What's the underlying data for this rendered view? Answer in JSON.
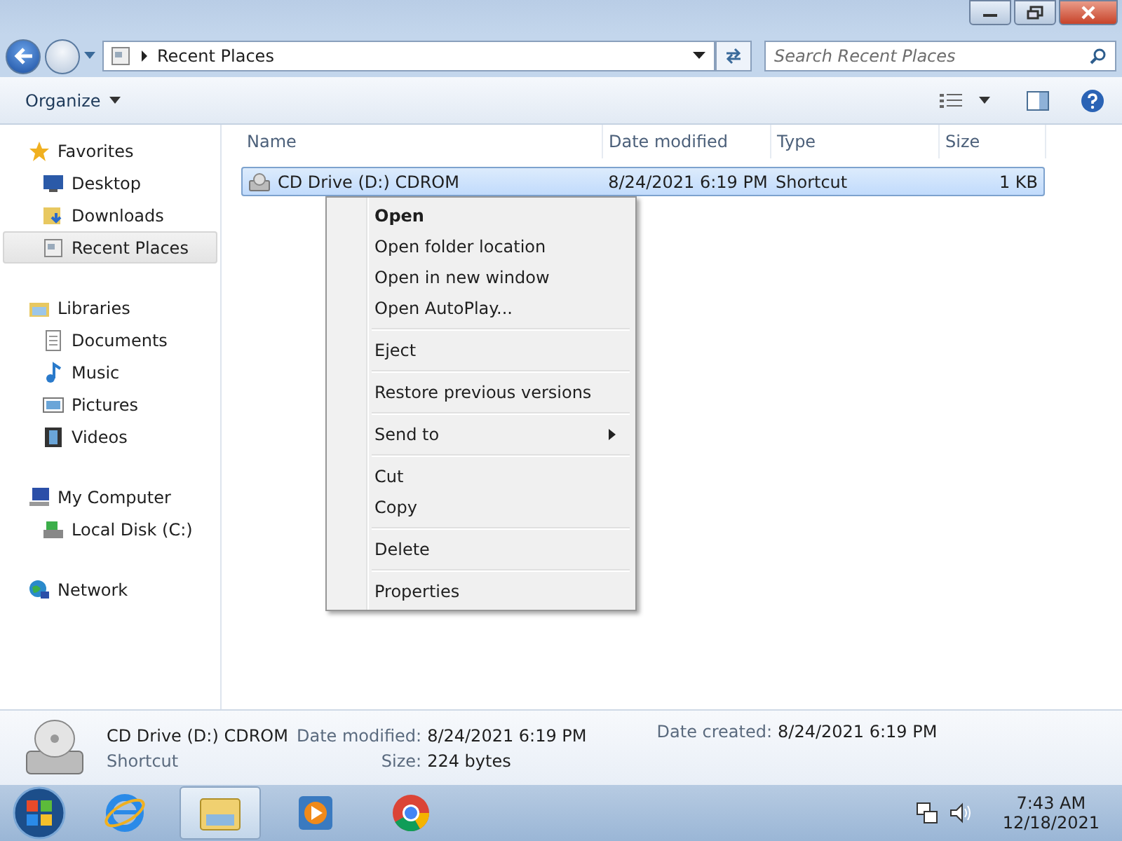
{
  "address_bar": {
    "location": "Recent Places"
  },
  "search": {
    "placeholder": "Search Recent Places"
  },
  "toolbar": {
    "organize": "Organize"
  },
  "sidebar": {
    "groups": [
      {
        "label": "Favorites",
        "selected": false,
        "children": [
          {
            "label": "Desktop",
            "selected": false
          },
          {
            "label": "Downloads",
            "selected": false
          },
          {
            "label": "Recent Places",
            "selected": true
          }
        ]
      },
      {
        "label": "Libraries",
        "selected": false,
        "children": [
          {
            "label": "Documents",
            "selected": false
          },
          {
            "label": "Music",
            "selected": false
          },
          {
            "label": "Pictures",
            "selected": false
          },
          {
            "label": "Videos",
            "selected": false
          }
        ]
      },
      {
        "label": "My Computer",
        "selected": false,
        "children": [
          {
            "label": "Local Disk (C:)",
            "selected": false
          }
        ]
      },
      {
        "label": "Network",
        "selected": false
      }
    ]
  },
  "table": {
    "columns": [
      "Name",
      "Date modified",
      "Type",
      "Size"
    ],
    "rows": [
      {
        "name": "CD Drive (D:) CDROM",
        "date_modified": "8/24/2021 6:19 PM",
        "type": "Shortcut",
        "size": "1 KB",
        "selected": true
      }
    ]
  },
  "context_menu": {
    "groups": [
      [
        {
          "label": "Open",
          "default": true,
          "submenu": false
        },
        {
          "label": "Open folder location",
          "default": false,
          "submenu": false
        },
        {
          "label": "Open in new window",
          "default": false,
          "submenu": false
        },
        {
          "label": "Open AutoPlay...",
          "default": false,
          "submenu": false
        }
      ],
      [
        {
          "label": "Eject",
          "default": false,
          "submenu": false
        }
      ],
      [
        {
          "label": "Restore previous versions",
          "default": false,
          "submenu": false
        }
      ],
      [
        {
          "label": "Send to",
          "default": false,
          "submenu": true
        }
      ],
      [
        {
          "label": "Cut",
          "default": false,
          "submenu": false
        },
        {
          "label": "Copy",
          "default": false,
          "submenu": false
        }
      ],
      [
        {
          "label": "Delete",
          "default": false,
          "submenu": false
        }
      ],
      [
        {
          "label": "Properties",
          "default": false,
          "submenu": false
        }
      ]
    ]
  },
  "details_pane": {
    "name": "CD Drive (D:) CDROM",
    "type": "Shortcut",
    "date_modified_label": "Date modified:",
    "date_modified": "8/24/2021 6:19 PM",
    "date_created_label": "Date created:",
    "date_created": "8/24/2021 6:19 PM",
    "size_label": "Size:",
    "size": "224 bytes"
  },
  "taskbar": {
    "apps": [
      {
        "selected": false
      },
      {
        "selected": true
      },
      {
        "selected": false
      },
      {
        "selected": false
      }
    ],
    "time": "7:43 AM",
    "date": "12/18/2021"
  }
}
